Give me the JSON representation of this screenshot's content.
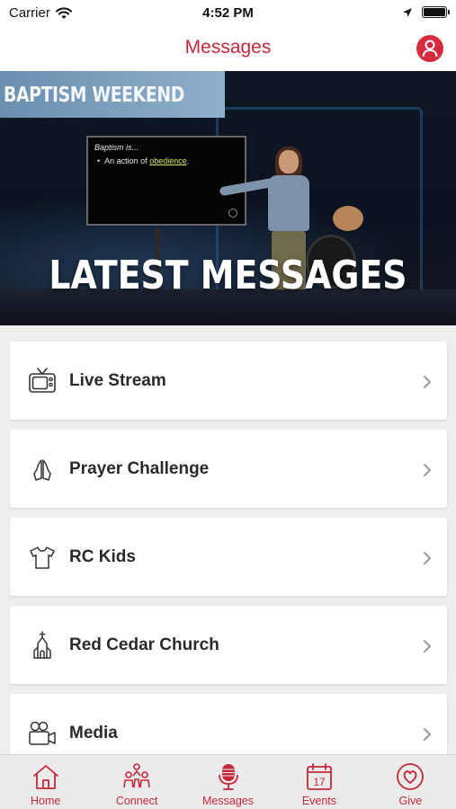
{
  "status_bar": {
    "carrier": "Carrier",
    "time": "4:52 PM",
    "battery_level": 1.0
  },
  "nav": {
    "title": "Messages",
    "profile_icon": "person-circle-icon"
  },
  "hero": {
    "banner_text": "BAPTISM WEEKEND",
    "slide_title": "Baptism is...",
    "slide_bullet_prefix": "An action of ",
    "slide_bullet_highlight": "obedience",
    "slide_bullet_suffix": ".",
    "title": "LATEST MESSAGES"
  },
  "list": [
    {
      "label": "Live Stream",
      "icon": "tv-icon"
    },
    {
      "label": "Prayer Challenge",
      "icon": "praying-hands-icon"
    },
    {
      "label": "RC Kids",
      "icon": "tshirt-icon"
    },
    {
      "label": "Red Cedar Church",
      "icon": "church-icon"
    },
    {
      "label": "Media",
      "icon": "video-camera-icon"
    }
  ],
  "tabs": [
    {
      "label": "Home",
      "icon": "house-icon"
    },
    {
      "label": "Connect",
      "icon": "people-icon"
    },
    {
      "label": "Messages",
      "icon": "microphone-icon",
      "selected": true
    },
    {
      "label": "Events",
      "icon": "calendar-icon",
      "calendar_day": "17"
    },
    {
      "label": "Give",
      "icon": "heart-circle-icon"
    }
  ],
  "colors": {
    "accent": "#c4283a",
    "profile_bg": "#d62b3d",
    "tab_bar_bg": "#ebebeb",
    "page_bg": "#eeeeee"
  }
}
